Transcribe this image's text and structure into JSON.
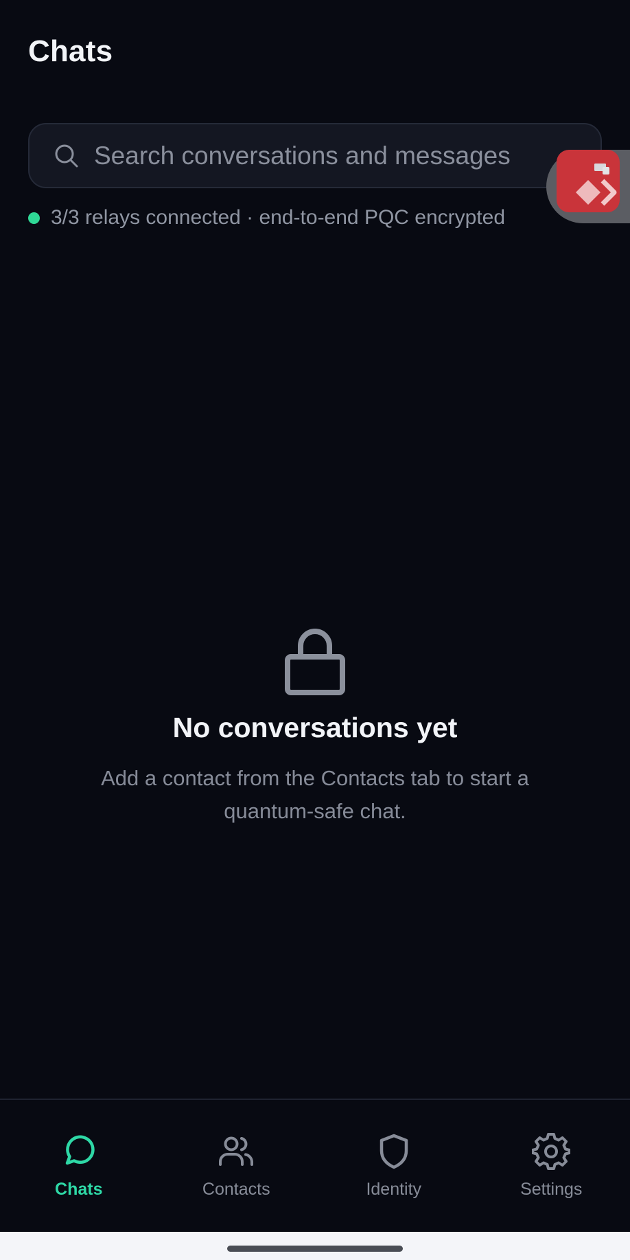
{
  "header": {
    "title": "Chats"
  },
  "search": {
    "placeholder": "Search conversations and messages",
    "value": ""
  },
  "relay_status": {
    "text": "3/3 relays connected · end-to-end PQC encrypted",
    "indicator_color": "#2fd896"
  },
  "empty_state": {
    "icon": "lock-icon",
    "title": "No conversations yet",
    "description": "Add a contact from the Contacts tab to start a quantum-safe chat."
  },
  "bottom_nav": {
    "active_color": "#2ed8a6",
    "items": [
      {
        "label": "Chats",
        "icon": "chat-bubble-icon",
        "active": true
      },
      {
        "label": "Contacts",
        "icon": "users-icon",
        "active": false
      },
      {
        "label": "Identity",
        "icon": "shield-icon",
        "active": false
      },
      {
        "label": "Settings",
        "icon": "gear-icon",
        "active": false
      }
    ]
  },
  "colors": {
    "background": "#080a12",
    "accent": "#2ed8a6",
    "floating_widget": "#c9343a"
  }
}
